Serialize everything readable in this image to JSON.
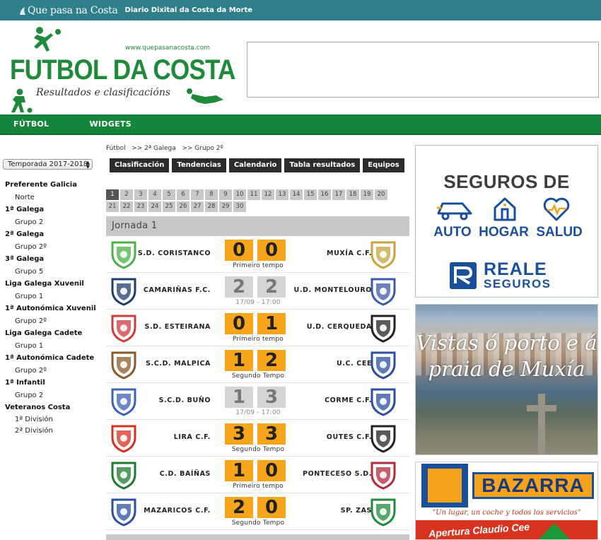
{
  "topbar": {
    "brand": "Que pasa na Costa",
    "tagline": "Diario Dixital da Costa da Morte"
  },
  "logo": {
    "title": "FUTBOL DA COSTA",
    "url": "www.quepasanacosta.com",
    "subtitle": "Resultados e clasificacións"
  },
  "nav": {
    "items": [
      "FÚTBOL",
      "WIDGETS"
    ]
  },
  "season": {
    "selected": "Temporada 2017-2018"
  },
  "menu": [
    {
      "label": "Preferente Galicia",
      "subs": [
        "Norte"
      ]
    },
    {
      "label": "1ª Galega",
      "subs": [
        "Grupo 2"
      ]
    },
    {
      "label": "2ª Galega",
      "subs": [
        "Grupo 2º"
      ]
    },
    {
      "label": "3ª Galega",
      "subs": [
        "Grupo 5"
      ]
    },
    {
      "label": "Liga Galega Xuvenil",
      "subs": [
        "Grupo 1"
      ]
    },
    {
      "label": "1ª Autonómica Xuvenil",
      "subs": [
        "Grupo 2º"
      ]
    },
    {
      "label": "Liga Galega Cadete",
      "subs": [
        "Grupo 1"
      ]
    },
    {
      "label": "1ª Autonómica Cadete",
      "subs": [
        "Grupo 2º"
      ]
    },
    {
      "label": "1ª Infantil",
      "subs": [
        "Grupo 2"
      ]
    },
    {
      "label": "Veteranos Costa",
      "subs": [
        "1ª División",
        "2ª División"
      ]
    }
  ],
  "breadcrumb": "Fútbol   >> 2ª Galega   >> Grupo 2º",
  "tabs": [
    "Clasificación",
    "Tendencias",
    "Calendario",
    "Tabla resultados",
    "Equipos"
  ],
  "rounds": [
    "1",
    "2",
    "3",
    "4",
    "5",
    "6",
    "7",
    "8",
    "9",
    "10",
    "11",
    "12",
    "13",
    "14",
    "15",
    "16",
    "17",
    "18",
    "19",
    "20",
    "21",
    "22",
    "23",
    "24",
    "25",
    "26",
    "27",
    "28",
    "29",
    "30"
  ],
  "active_round": "1",
  "jornada": "Jornada 1",
  "matches": [
    {
      "home": "S.D. CORISTANCO",
      "away": "MUXÍA C.F.",
      "hs": "0",
      "as": "0",
      "status": "Primeiro tempo",
      "state": "live",
      "hc": "#4ab04a",
      "ac": "#c9a23a"
    },
    {
      "home": "CAMARIÑAS F.C.",
      "away": "U.D. MONTELOURO",
      "hs": "2",
      "as": "2",
      "status": "17/09 - 17:00",
      "state": "pending",
      "hc": "#1d3d6e",
      "ac": "#3d5aa8"
    },
    {
      "home": "S.D. ESTEIRANA",
      "away": "U.D. CERQUEDA",
      "hs": "0",
      "as": "1",
      "status": "Primeiro tempo",
      "state": "live",
      "hc": "#d23a3a",
      "ac": "#222222"
    },
    {
      "home": "S.C.D. MALPICA",
      "away": "U.C. CEE",
      "hs": "1",
      "as": "2",
      "status": "Segundo Tempo",
      "state": "live",
      "hc": "#8a5a2a",
      "ac": "#2a4fa0"
    },
    {
      "home": "S.C.D. BUÑO",
      "away": "CORME C.F.",
      "hs": "1",
      "as": "3",
      "status": "17/09 - 17:00",
      "state": "pending",
      "hc": "#3a62b8",
      "ac": "#2a4fa0"
    },
    {
      "home": "LIRA C.F.",
      "away": "OUTES C.F.",
      "hs": "3",
      "as": "3",
      "status": "Segundo Tempo",
      "state": "live",
      "hc": "#d8301e",
      "ac": "#222222"
    },
    {
      "home": "C.D. BAÍÑAS",
      "away": "PONTECESO S.D.",
      "hs": "1",
      "as": "0",
      "status": "Primeiro tempo",
      "state": "live",
      "hc": "#1f7a2e",
      "ac": "#b02a3a"
    },
    {
      "home": "MAZARICOS C.F.",
      "away": "SP. ZAS",
      "hs": "2",
      "as": "0",
      "status": "Segundo Tempo",
      "state": "live",
      "hc": "#2a4fa0",
      "ac": "#1f8a3a"
    }
  ],
  "ads": {
    "seguros": {
      "head": "SEGUROS DE",
      "cats": [
        "AUTO",
        "HOGAR",
        "SALUD"
      ],
      "brand1": "REALE",
      "brand2": "SEGUROS"
    },
    "muxia": {
      "text": "Vistas ó porto e á praia de Muxía"
    },
    "bazarra": {
      "brand": "BAZARRA",
      "slogan": "\"Un lugar, un coche y todos los servicios\"",
      "strip": "Apertura Claudio Cee"
    }
  },
  "colors": {
    "topbar": "#2d7f8a",
    "nav": "#14863c",
    "score_live": "#f7a51b",
    "score_pending": "#d5d5d5",
    "brand_green": "#1f8a3a"
  }
}
